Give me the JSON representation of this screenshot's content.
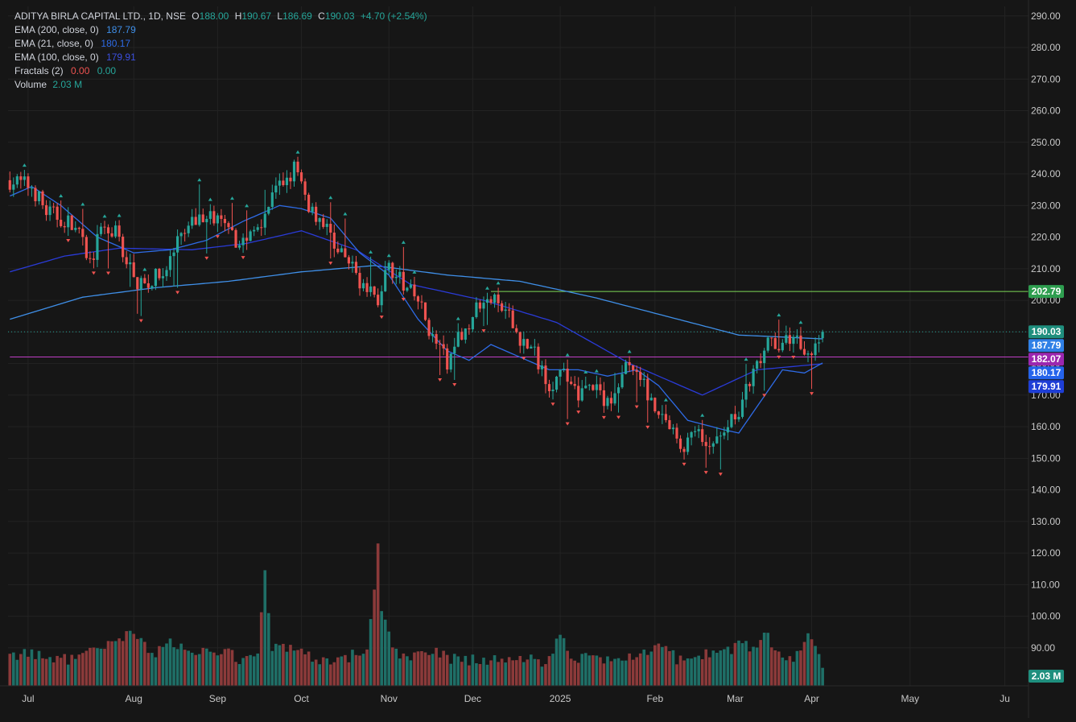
{
  "colors": {
    "background": "#161616",
    "grid": "#232323",
    "axis_text": "#c8c8c8",
    "up": "#26a69a",
    "down": "#ef5350",
    "up_volume": "#1f6f67",
    "down_volume": "#8b3a3a",
    "ema200": "#3f8fe8",
    "ema21": "#2e6be6",
    "ema100": "#2a3bd8",
    "hline_green": "#7ed957",
    "hline_magenta": "#c13fc6",
    "price_line": "#26a69a"
  },
  "legend": {
    "symbol": "ADITYA BIRLA CAPITAL LTD., 1D, NSE",
    "open_label": "O",
    "open": "188.00",
    "high_label": "H",
    "high": "190.67",
    "low_label": "L",
    "low": "186.69",
    "close_label": "C",
    "close": "190.03",
    "change": "+4.70 (+2.54%)",
    "ema200_label": "EMA (200, close, 0)",
    "ema200_value": "187.79",
    "ema21_label": "EMA (21, close, 0)",
    "ema21_value": "180.17",
    "ema100_label": "EMA (100, close, 0)",
    "ema100_value": "179.91",
    "fractals_label": "Fractals (2)",
    "fractal_down": "0.00",
    "fractal_up": "0.00",
    "volume_label": "Volume",
    "volume_value": "2.03 M"
  },
  "chart_data": {
    "type": "candlestick",
    "y_axis": {
      "range": [
        78,
        293
      ],
      "ticks": [
        "90.00",
        "100.00",
        "110.00",
        "120.00",
        "130.00",
        "140.00",
        "150.00",
        "160.00",
        "170.00",
        "180.00",
        "190.00",
        "200.00",
        "210.00",
        "220.00",
        "230.00",
        "240.00",
        "250.00",
        "260.00",
        "270.00",
        "280.00",
        "290.00"
      ],
      "tick_values": [
        90,
        100,
        110,
        120,
        130,
        140,
        150,
        160,
        170,
        180,
        190,
        200,
        210,
        220,
        230,
        240,
        250,
        260,
        270,
        280,
        290
      ]
    },
    "x_axis": {
      "labels": [
        "Jul",
        "Aug",
        "Sep",
        "Oct",
        "Nov",
        "Dec",
        "2025",
        "Feb",
        "Mar",
        "Apr",
        "May",
        "Ju"
      ],
      "label_bar_index": [
        5,
        34,
        57,
        80,
        104,
        127,
        151,
        177,
        199,
        220,
        247,
        273
      ]
    },
    "bar_count": 280,
    "ohlc_anchors": [
      [
        0,
        238
      ],
      [
        6,
        236
      ],
      [
        10,
        228
      ],
      [
        14,
        226
      ],
      [
        18,
        223
      ],
      [
        22,
        212
      ],
      [
        26,
        224
      ],
      [
        30,
        220
      ],
      [
        34,
        206
      ],
      [
        38,
        206
      ],
      [
        42,
        208
      ],
      [
        46,
        218
      ],
      [
        50,
        224
      ],
      [
        54,
        228
      ],
      [
        58,
        224
      ],
      [
        62,
        218
      ],
      [
        66,
        220
      ],
      [
        70,
        228
      ],
      [
        74,
        236
      ],
      [
        78,
        242
      ],
      [
        82,
        230
      ],
      [
        86,
        225
      ],
      [
        90,
        215
      ],
      [
        94,
        210
      ],
      [
        98,
        203
      ],
      [
        101,
        200
      ],
      [
        104,
        212
      ],
      [
        108,
        204
      ],
      [
        112,
        200
      ],
      [
        116,
        188
      ],
      [
        120,
        180
      ],
      [
        124,
        190
      ],
      [
        128,
        197
      ],
      [
        132,
        200
      ],
      [
        136,
        196
      ],
      [
        140,
        188
      ],
      [
        144,
        183
      ],
      [
        148,
        174
      ],
      [
        152,
        176
      ],
      [
        156,
        171
      ],
      [
        160,
        173
      ],
      [
        164,
        167
      ],
      [
        168,
        178
      ],
      [
        172,
        176
      ],
      [
        176,
        169
      ],
      [
        180,
        162
      ],
      [
        184,
        153
      ],
      [
        188,
        158
      ],
      [
        192,
        153
      ],
      [
        196,
        160
      ],
      [
        200,
        166
      ],
      [
        204,
        176
      ],
      [
        208,
        186
      ],
      [
        212,
        184
      ],
      [
        215,
        190
      ],
      [
        218,
        182
      ],
      [
        221,
        186
      ],
      [
        223,
        190
      ]
    ],
    "last_bar_index": 223,
    "last_ohlc": {
      "open": 188.0,
      "high": 190.67,
      "low": 186.69,
      "close": 190.03
    },
    "ema_anchors": {
      "ema200": [
        [
          0,
          194
        ],
        [
          20,
          201
        ],
        [
          40,
          204
        ],
        [
          60,
          206
        ],
        [
          80,
          209
        ],
        [
          100,
          211
        ],
        [
          120,
          208
        ],
        [
          140,
          206
        ],
        [
          160,
          201
        ],
        [
          180,
          195
        ],
        [
          200,
          189
        ],
        [
          223,
          187.79
        ]
      ],
      "ema100": [
        [
          0,
          209
        ],
        [
          15,
          214
        ],
        [
          30,
          216.5
        ],
        [
          50,
          216
        ],
        [
          65,
          218
        ],
        [
          80,
          222
        ],
        [
          95,
          216
        ],
        [
          110,
          205
        ],
        [
          130,
          200
        ],
        [
          150,
          193
        ],
        [
          170,
          180
        ],
        [
          190,
          170
        ],
        [
          205,
          178
        ],
        [
          223,
          179.91
        ]
      ],
      "ema21": [
        [
          0,
          233
        ],
        [
          6,
          236
        ],
        [
          14,
          230
        ],
        [
          24,
          220
        ],
        [
          34,
          215
        ],
        [
          44,
          216
        ],
        [
          54,
          219
        ],
        [
          64,
          225
        ],
        [
          74,
          230
        ],
        [
          80,
          229
        ],
        [
          88,
          226
        ],
        [
          96,
          215
        ],
        [
          104,
          208
        ],
        [
          112,
          194
        ],
        [
          120,
          184
        ],
        [
          126,
          181
        ],
        [
          132,
          186
        ],
        [
          140,
          182
        ],
        [
          148,
          178
        ],
        [
          156,
          178
        ],
        [
          164,
          176
        ],
        [
          172,
          178
        ],
        [
          178,
          173
        ],
        [
          186,
          162
        ],
        [
          196,
          159
        ],
        [
          200,
          158
        ],
        [
          206,
          168
        ],
        [
          212,
          178
        ],
        [
          218,
          177
        ],
        [
          223,
          180.17
        ]
      ]
    },
    "volume_anchors": [
      [
        0,
        88
      ],
      [
        6,
        88
      ],
      [
        12,
        86
      ],
      [
        18,
        87
      ],
      [
        24,
        89
      ],
      [
        30,
        92
      ],
      [
        34,
        96
      ],
      [
        38,
        88
      ],
      [
        44,
        91
      ],
      [
        50,
        90
      ],
      [
        56,
        88
      ],
      [
        60,
        88
      ],
      [
        64,
        86
      ],
      [
        68,
        90
      ],
      [
        70,
        114
      ],
      [
        72,
        90
      ],
      [
        76,
        90
      ],
      [
        80,
        88
      ],
      [
        86,
        86
      ],
      [
        92,
        87
      ],
      [
        98,
        89
      ],
      [
        100,
        110
      ],
      [
        101,
        122
      ],
      [
        102,
        100
      ],
      [
        106,
        88
      ],
      [
        112,
        88
      ],
      [
        116,
        89
      ],
      [
        120,
        87
      ],
      [
        126,
        86
      ],
      [
        132,
        86
      ],
      [
        140,
        86
      ],
      [
        148,
        86
      ],
      [
        151,
        96
      ],
      [
        154,
        87
      ],
      [
        160,
        87
      ],
      [
        166,
        86
      ],
      [
        172,
        87
      ],
      [
        178,
        90
      ],
      [
        184,
        86
      ],
      [
        190,
        88
      ],
      [
        196,
        88
      ],
      [
        200,
        92
      ],
      [
        204,
        90
      ],
      [
        208,
        94
      ],
      [
        212,
        86
      ],
      [
        216,
        88
      ],
      [
        219,
        95
      ],
      [
        223,
        84
      ]
    ],
    "volume_unit_note": "",
    "horizontal_lines": [
      {
        "price": 202.79,
        "label": "202.79",
        "color_key": "hline_green",
        "from_bar": 132
      },
      {
        "price": 182.07,
        "label": "182.07",
        "color_key": "hline_magenta",
        "from_bar": 0
      }
    ],
    "price_badges": [
      {
        "label": "190.03",
        "price": 190.03,
        "color": "#1f8f7e"
      },
      {
        "label": "187.79",
        "price": 187.79,
        "color": "#2f80e6"
      },
      {
        "label": "182.07",
        "price": 182.07,
        "color": "#9c27b0"
      },
      {
        "label": "180.17",
        "price": 180.17,
        "color": "#2563eb"
      },
      {
        "label": "179.91",
        "price": 179.91,
        "color": "#1e3ed6"
      }
    ],
    "current_price": 190.03,
    "volume_badge": "2.03 M"
  }
}
